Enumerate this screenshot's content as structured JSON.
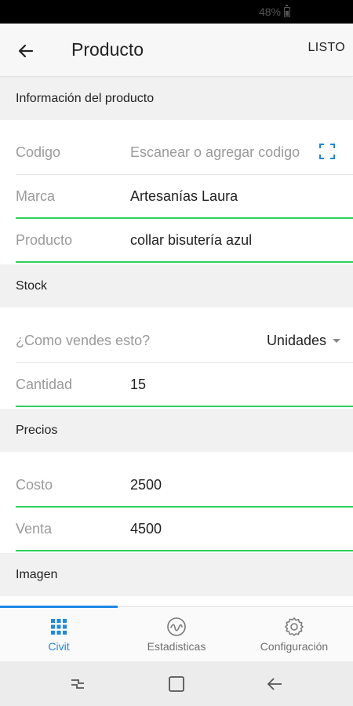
{
  "status_bar": {
    "battery": "48%"
  },
  "app_bar": {
    "title": "Producto",
    "done_label": "LISTO"
  },
  "sections": {
    "product_info": "Información del producto",
    "stock": "Stock",
    "prices": "Precios",
    "image": "Imagen"
  },
  "product": {
    "code": {
      "label": "Codigo",
      "placeholder": "Escanear o agregar codigo"
    },
    "brand": {
      "label": "Marca",
      "value": "Artesanías Laura"
    },
    "name": {
      "label": "Producto",
      "value": "collar bisutería azul"
    }
  },
  "stock": {
    "sell_by": {
      "label": "¿Como vendes esto?",
      "value": "Unidades"
    },
    "quantity": {
      "label": "Cantidad",
      "value": "15"
    }
  },
  "prices": {
    "cost": {
      "label": "Costo",
      "value": "2500"
    },
    "sale": {
      "label": "Venta",
      "value": "4500"
    }
  },
  "bottom_nav": {
    "items": [
      {
        "label": "Civit",
        "icon": "grid-icon",
        "active": true
      },
      {
        "label": "Estadisticas",
        "icon": "chart-wave-icon",
        "active": false
      },
      {
        "label": "Configuración",
        "icon": "gear-icon",
        "active": false
      }
    ]
  },
  "colors": {
    "accent": "#1e88e5",
    "underline": "#2ed15a"
  }
}
